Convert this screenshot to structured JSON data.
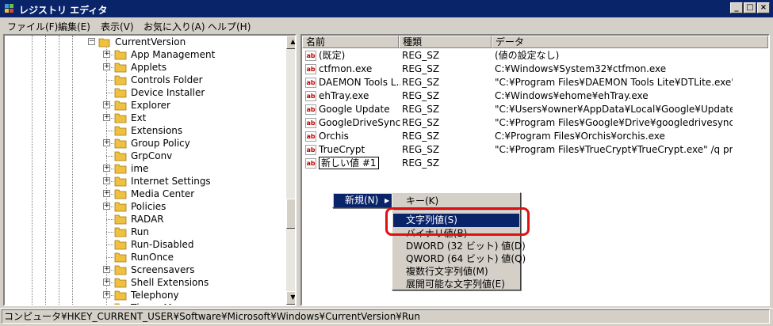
{
  "window": {
    "title": "レジストリ エディタ",
    "minimize": "_",
    "maximize": "□",
    "close": "×"
  },
  "menubar": [
    "ファイル(F)",
    "編集(E)",
    "表示(V)",
    "お気に入り(A)",
    "ヘルプ(H)"
  ],
  "tree": {
    "current": "CurrentVersion",
    "items": [
      {
        "label": "App Management",
        "expandable": true
      },
      {
        "label": "Applets",
        "expandable": true
      },
      {
        "label": "Controls Folder",
        "expandable": false
      },
      {
        "label": "Device Installer",
        "expandable": false
      },
      {
        "label": "Explorer",
        "expandable": true
      },
      {
        "label": "Ext",
        "expandable": true
      },
      {
        "label": "Extensions",
        "expandable": false
      },
      {
        "label": "Group Policy",
        "expandable": true
      },
      {
        "label": "GrpConv",
        "expandable": false
      },
      {
        "label": "ime",
        "expandable": true
      },
      {
        "label": "Internet Settings",
        "expandable": true
      },
      {
        "label": "Media Center",
        "expandable": true
      },
      {
        "label": "Policies",
        "expandable": true
      },
      {
        "label": "RADAR",
        "expandable": false
      },
      {
        "label": "Run",
        "expandable": false
      },
      {
        "label": "Run-Disabled",
        "expandable": false
      },
      {
        "label": "RunOnce",
        "expandable": false
      },
      {
        "label": "Screensavers",
        "expandable": true
      },
      {
        "label": "Shell Extensions",
        "expandable": true
      },
      {
        "label": "Telephony",
        "expandable": true
      },
      {
        "label": "ThemeM...",
        "expandable": false
      }
    ]
  },
  "list": {
    "headers": [
      "名前",
      "種類",
      "データ"
    ],
    "rows": [
      {
        "name": "(既定)",
        "type": "REG_SZ",
        "data": "(値の設定なし)"
      },
      {
        "name": "ctfmon.exe",
        "type": "REG_SZ",
        "data": "C:¥Windows¥System32¥ctfmon.exe"
      },
      {
        "name": "DAEMON Tools L...",
        "type": "REG_SZ",
        "data": "\"C:¥Program Files¥DAEMON Tools Lite¥DTLite.exe\"..."
      },
      {
        "name": "ehTray.exe",
        "type": "REG_SZ",
        "data": "C:¥Windows¥ehome¥ehTray.exe"
      },
      {
        "name": "Google Update",
        "type": "REG_SZ",
        "data": "\"C:¥Users¥owner¥AppData¥Local¥Google¥Update¥G..."
      },
      {
        "name": "GoogleDriveSync",
        "type": "REG_SZ",
        "data": "\"C:¥Program Files¥Google¥Drive¥googledrivesync.ex..."
      },
      {
        "name": "Orchis",
        "type": "REG_SZ",
        "data": "C:¥Program Files¥Orchis¥orchis.exe"
      },
      {
        "name": "TrueCrypt",
        "type": "REG_SZ",
        "data": "\"C:¥Program Files¥TrueCrypt¥TrueCrypt.exe\" /q pre..."
      },
      {
        "name": "新しい値 #1",
        "type": "REG_SZ",
        "data": ""
      }
    ]
  },
  "context_menu": {
    "parent_label": "新規(N)",
    "parent_arrow": "▶",
    "submenu": [
      {
        "label": "キー(K)",
        "selected": false
      },
      {
        "label": "文字列値(S)",
        "selected": true
      },
      {
        "label": "バイナリ値(B)",
        "selected": false
      },
      {
        "label": "DWORD (32 ビット) 値(D)",
        "selected": false
      },
      {
        "label": "QWORD (64 ビット) 値(Q)",
        "selected": false
      },
      {
        "label": "複数行文字列値(M)",
        "selected": false
      },
      {
        "label": "展開可能な文字列値(E)",
        "selected": false
      }
    ]
  },
  "status": "コンピュータ¥HKEY_CURRENT_USER¥Software¥Microsoft¥Windows¥CurrentVersion¥Run",
  "colors": {
    "titlebar": "#0a246a",
    "highlight": "#0a246a",
    "callout": "#e01010",
    "folder": "#f0c040"
  }
}
